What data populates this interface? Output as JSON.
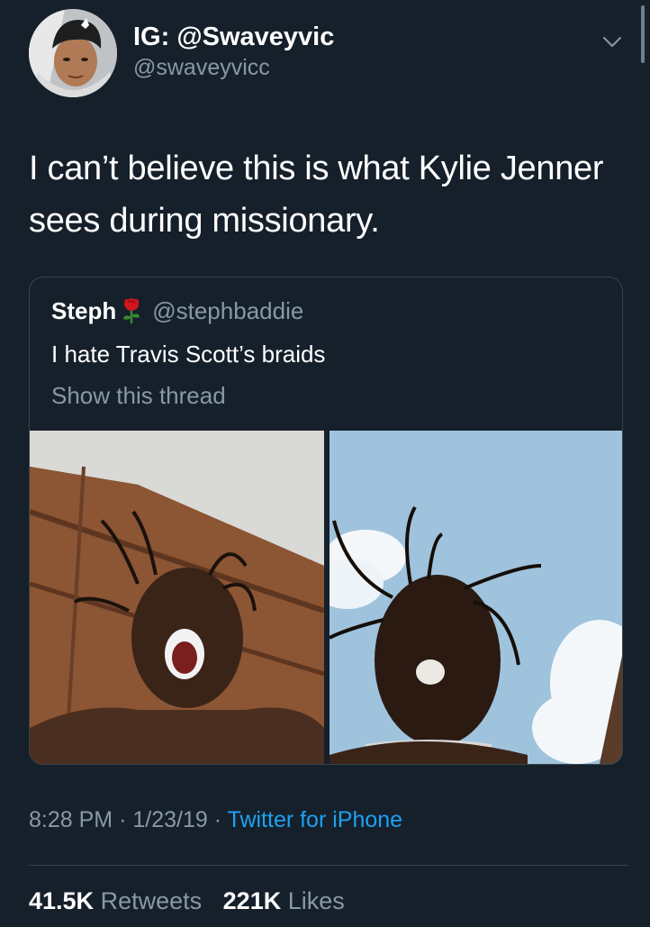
{
  "tweet": {
    "author": {
      "display_name": "IG: @Swaveyvic",
      "handle": "@swaveyvicc"
    },
    "text": "I can’t believe this is what Kylie Jenner sees during missionary.",
    "quoted": {
      "display_name": "Steph",
      "emoji": "rose-icon",
      "handle": "@stephbaddie",
      "text": "I hate Travis Scott’s braids",
      "show_thread": "Show this thread"
    },
    "meta": {
      "time": "8:28 PM",
      "separator": "·",
      "date": "1/23/19",
      "source": "Twitter for iPhone"
    },
    "stats": {
      "retweets_count": "41.5K",
      "retweets_label": "Retweets",
      "likes_count": "221K",
      "likes_label": "Likes"
    }
  },
  "theme": {
    "background": "#15202b",
    "secondary_text": "#8899a6",
    "accent": "#1da1f2",
    "border": "#38444d"
  }
}
